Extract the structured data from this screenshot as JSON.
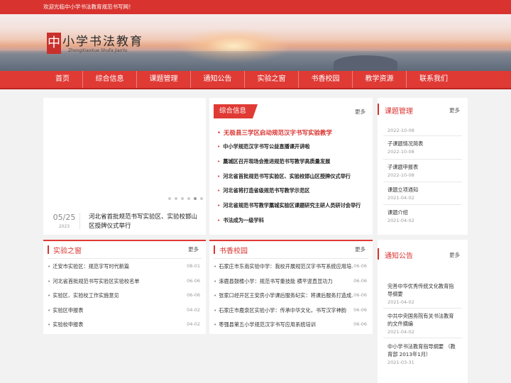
{
  "topbar": {
    "welcome": "欢迎光临中小学书法教育规范书写网！"
  },
  "logo": {
    "seal": "中",
    "cn": "小学书法教育",
    "pinyin": "ZhongXiaoXue ShuFa JiaoYu"
  },
  "nav": {
    "items": [
      "首页",
      "综合信息",
      "课题管理",
      "通知公告",
      "实验之窗",
      "书香校园",
      "教学资源",
      "联系我们"
    ]
  },
  "slider": {
    "date_md": "05/25",
    "date_year": "2023",
    "caption": "河北省首批规范书写实验区、实验校邯山区授牌仪式举行",
    "dots": 6,
    "active_dot": 5
  },
  "news": {
    "title": "综合信息",
    "more": "更多",
    "headline": "无极县三学区启动规范汉字书写实验教学",
    "items": [
      "中小学规范汉字书写公益直播课开讲啦",
      "藁城区召开现场会推进规范书写教学高质量发展",
      "河北省首批规范书写实验区、实验校邯山区授牌仪式举行",
      "河北省将打造省级规范书写教学示范区",
      "河北省规范书写教学藁城实验区课题研究主研人员研讨会举行",
      "书法成为一级学科"
    ]
  },
  "projects": {
    "title": "课题管理",
    "more": "更多",
    "entries": [
      {
        "title": "",
        "date": "2022-10-08"
      },
      {
        "title": "子课题情况简表",
        "date": "2022-10-08"
      },
      {
        "title": "子课题申报表",
        "date": "2022-10-08"
      },
      {
        "title": "课题立项通知",
        "date": "2021-04-02"
      },
      {
        "title": "课题介绍",
        "date": "2021-04-02"
      }
    ]
  },
  "lab": {
    "title": "实验之窗",
    "more": "更多",
    "items": [
      {
        "text": "迁安市实验区：规范字写时代新篇",
        "date": "08-01"
      },
      {
        "text": "河北省首批规范书写实验区实验校名单",
        "date": "06-06"
      },
      {
        "text": "实验区、实验校工作实施意见",
        "date": "06-06"
      },
      {
        "text": "实验区申报表",
        "date": "04-02"
      },
      {
        "text": "实验校申报表",
        "date": "04-02"
      }
    ]
  },
  "campus": {
    "title": "书香校园",
    "more": "更多",
    "items": [
      {
        "text": "石家庄市东南实验中学：我校开展规范汉字书写系统应用培...",
        "date": "06-06"
      },
      {
        "text": "涿鹿县鼓楼小学：规范书写重技能 横平竖直显功力",
        "date": "06-06"
      },
      {
        "text": "张家口经开区王安房小学课后服务纪实：将课后服务打造成...",
        "date": "06-06"
      },
      {
        "text": "石家庄市鹿泉区实验小学：传承中华文化，书写汉字神韵",
        "date": "06-06"
      },
      {
        "text": "枣强县第五小学规范汉字书写应用系统培训",
        "date": "06-06"
      }
    ]
  },
  "notices": {
    "title": "通知公告",
    "more": "更多",
    "entries": [
      {
        "title": "完善中华优秀传统文化教育指导纲要",
        "date": "2021-04-02"
      },
      {
        "title": "中共中央国务院有关书法教育的文件摘编",
        "date": "2021-04-02"
      },
      {
        "title": "中小学书法教育指导纲要 （教育部 2013年1月）",
        "date": "2021-03-31"
      }
    ]
  }
}
